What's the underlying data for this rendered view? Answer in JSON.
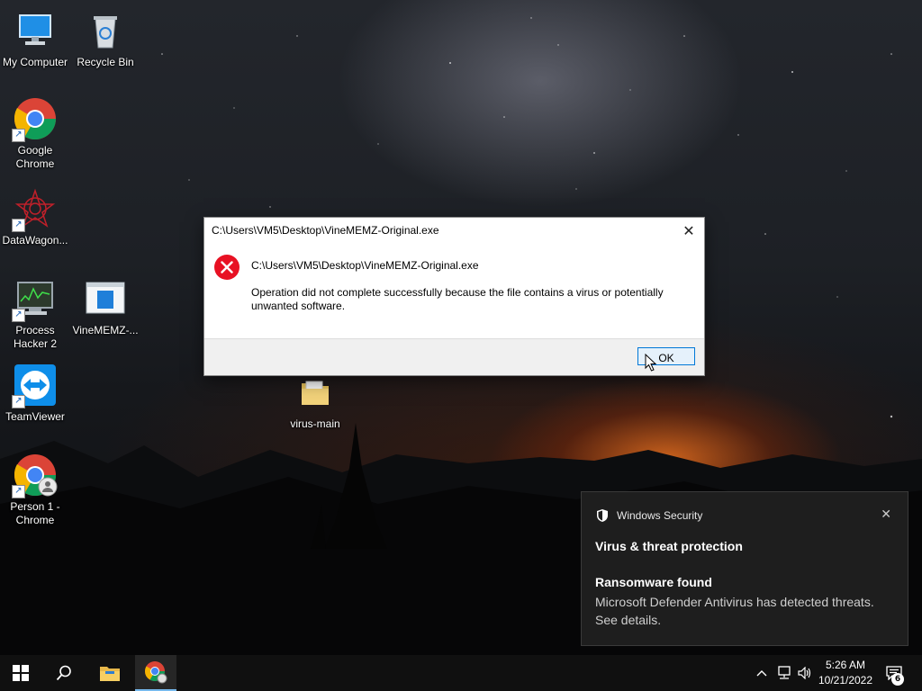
{
  "desktop": {
    "icons": [
      {
        "label": "My Computer"
      },
      {
        "label": "Recycle Bin"
      },
      {
        "label": "Google Chrome"
      },
      {
        "label": "DataWagon..."
      },
      {
        "label": "Process Hacker 2"
      },
      {
        "label": "VineMEMZ-..."
      },
      {
        "label": "TeamViewer"
      },
      {
        "label": "virus-main"
      },
      {
        "label": "Person 1 - Chrome"
      }
    ]
  },
  "dialog": {
    "title": "C:\\Users\\VM5\\Desktop\\VineMEMZ-Original.exe",
    "path": "C:\\Users\\VM5\\Desktop\\VineMEMZ-Original.exe",
    "message": "Operation did not complete successfully because the file contains a virus or potentially unwanted software.",
    "ok_label": "OK",
    "close_glyph": "✕",
    "icon": "error-icon",
    "error_color": "#e81123"
  },
  "toast": {
    "app_name": "Windows Security",
    "heading": "Virus & threat protection",
    "subheading": "Ransomware found",
    "detail": "Microsoft Defender Antivirus has detected threats.  See details.",
    "close_glyph": "✕"
  },
  "taskbar": {
    "time": "5:26 AM",
    "date": "10/21/2022",
    "notification_count": "6",
    "accent_color": "#76b9ed"
  }
}
